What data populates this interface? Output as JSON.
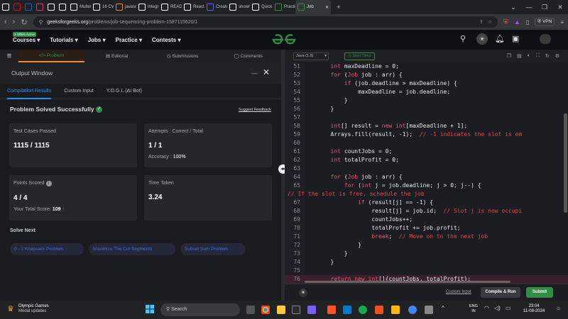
{
  "browser": {
    "tabs": [
      {
        "label": "",
        "icon": "github-icon",
        "color": "#ffffff"
      },
      {
        "label": "",
        "icon": "youtube-icon",
        "color": "#ff0000"
      },
      {
        "label": "",
        "icon": "linkedin-icon",
        "color": "#0a66c2"
      },
      {
        "label": "",
        "icon": "instagram-icon",
        "color": "#e1306c"
      },
      {
        "label": "",
        "icon": "pinterest-icon",
        "color": "#ffffff"
      },
      {
        "label": "",
        "icon": "hashnode-icon",
        "color": "#ffffff"
      },
      {
        "label": "Multer (",
        "icon": "page-icon",
        "color": "#ffffff"
      },
      {
        "label": "16 CV Te",
        "icon": "medium-icon",
        "color": "#ffffff"
      },
      {
        "label": "javascrip",
        "icon": "stackoverflow-icon",
        "color": "#f48024"
      },
      {
        "label": "Integrati",
        "icon": "page-icon",
        "color": "#ffffff"
      },
      {
        "label": "README",
        "icon": "github-icon",
        "color": "#ffffff"
      },
      {
        "label": "React Vi",
        "icon": "page-icon",
        "color": "#ffffff"
      },
      {
        "label": "Create a",
        "icon": "page-icon",
        "color": "#5865f2"
      },
      {
        "label": "showrev",
        "icon": "google-icon",
        "color": "#ffffff"
      },
      {
        "label": "Quick St",
        "icon": "settings-icon",
        "color": "#ffffff"
      },
      {
        "label": "Practic",
        "icon": "gfg-icon",
        "color": "#2f8d46"
      },
      {
        "label": "Job",
        "icon": "gfg-icon",
        "color": "#2f8d46",
        "active": true
      }
    ],
    "new_tab": "+",
    "window_controls": [
      "⌄",
      "—",
      "❐",
      "✕"
    ],
    "url_domain": "geeksforgeeks.org",
    "url_path": "/problems/job-sequencing-problem-1587115620/1",
    "vpn_label": "VPN"
  },
  "site_nav": {
    "courses": "Courses",
    "courses_badge": "2 Offers Active",
    "tutorials": "Tutorials",
    "jobs": "Jobs",
    "practice": "Practice",
    "contests": "Contests",
    "logo": "GfG"
  },
  "problem_tabs": {
    "problem": "Problem",
    "editorial": "Editorial",
    "submissions": "Submissions",
    "comments": "Comments"
  },
  "output": {
    "title": "Output Window",
    "tabs": [
      "Compilation Results",
      "Custom Input",
      "Y.O.G.I. (AI Bot)"
    ],
    "status": "Problem Solved Successfully",
    "feedback": "Suggest Feedback",
    "test_cases_label": "Test Cases Passed",
    "test_cases_value": "1115 / 1115",
    "attempts_label": "Attempts : Correct / Total",
    "attempts_value": "1 / 1",
    "accuracy_label": "Accuracy :",
    "accuracy_value": "100%",
    "points_label": "Points Scored",
    "points_value": "4 / 4",
    "total_score_label": "Your Total Score:",
    "total_score_value": "109",
    "time_label": "Time Taken",
    "time_value": "3.24",
    "solve_next_label": "Solve Next",
    "solve_next": [
      "0 - 1 Knapsack Problem",
      "Maximize The Cut Segments",
      "Subset Sum Problem"
    ]
  },
  "editor": {
    "language": "Java (1.8)",
    "timer": "Start Timer",
    "lines": [
      {
        "n": "51",
        "code": "        int maxDeadline = 0;"
      },
      {
        "n": "52",
        "code": "        for (Job job : arr) {"
      },
      {
        "n": "53",
        "code": "            if (job.deadline > maxDeadline) {"
      },
      {
        "n": "54",
        "code": "                maxDeadline = job.deadline;"
      },
      {
        "n": "55",
        "code": "            }"
      },
      {
        "n": "56",
        "code": "        }"
      },
      {
        "n": "57",
        "code": ""
      },
      {
        "n": "58",
        "code": "        int[] result = new int[maxDeadline + 1];"
      },
      {
        "n": "59",
        "code": "        Arrays.fill(result, -1);  // -1 indicates the slot is em"
      },
      {
        "n": "60",
        "code": ""
      },
      {
        "n": "61",
        "code": "        int countJobs = 0;"
      },
      {
        "n": "62",
        "code": "        int totalProfit = 0;"
      },
      {
        "n": "63",
        "code": ""
      },
      {
        "n": "64",
        "code": "        for (Job job : arr) {"
      },
      {
        "n": "65",
        "code": "            for (int j = job.deadline; j > 0; j--) {"
      },
      {
        "n": "",
        "code": "// If the slot is free, schedule the job"
      },
      {
        "n": "67",
        "code": "                if (result[j] == -1) {"
      },
      {
        "n": "68",
        "code": "                    result[j] = job.id;  // Slot j is now occupi"
      },
      {
        "n": "69",
        "code": "                    countJobs++;"
      },
      {
        "n": "70",
        "code": "                    totalProfit += job.profit;"
      },
      {
        "n": "71",
        "code": "                    break;  // Move on to the next job"
      },
      {
        "n": "72",
        "code": "                }"
      },
      {
        "n": "73",
        "code": "            }"
      },
      {
        "n": "74",
        "code": "        }"
      },
      {
        "n": "75",
        "code": ""
      },
      {
        "n": "76",
        "code": "        return new int[]{countJobs, totalProfit};"
      }
    ],
    "custom_input": "Custom Input",
    "compile_run": "Compile & Run",
    "submit": "Submit"
  },
  "taskbar": {
    "weather_title": "Olympic Games",
    "weather_sub": "Medal updates",
    "search": "Search",
    "lang1": "ENG",
    "lang2": "IN",
    "time": "23:04",
    "date": "11-08-2024"
  }
}
